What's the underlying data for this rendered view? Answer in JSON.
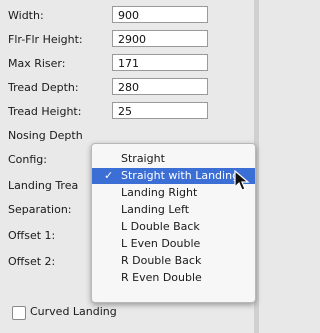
{
  "fields": [
    {
      "label": "Width:",
      "value": "900"
    },
    {
      "label": "Flr-Flr Height:",
      "value": "2900"
    },
    {
      "label": "Max Riser:",
      "value": "171"
    },
    {
      "label": "Tread Depth:",
      "value": "280"
    },
    {
      "label": "Tread Height:",
      "value": "25"
    }
  ],
  "labels": {
    "nosing_depth": "Nosing Depth",
    "config": "Config:",
    "landing_tread": "Landing Trea",
    "separation": "Separation:",
    "offset1": "Offset 1:",
    "offset2": "Offset 2:"
  },
  "menu": {
    "check_mark": "✓",
    "items": [
      "Straight",
      "Straight with Landing",
      "Landing Right",
      "Landing Left",
      "L Double Back",
      "L Even Double",
      "R Double Back",
      "R Even Double"
    ],
    "selected_index": 1
  },
  "curved_landing": {
    "label": "Curved Landing",
    "checked": false
  },
  "colors": {
    "selection": "#3b6fd6",
    "panel": "#e9e9e9"
  }
}
